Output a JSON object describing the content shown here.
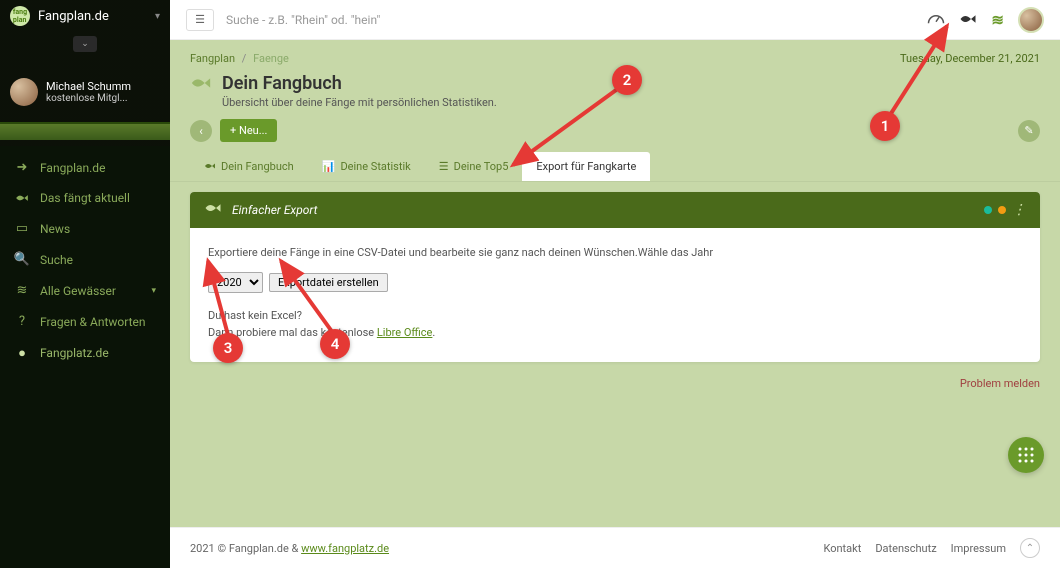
{
  "brand": {
    "name": "Fangplan.de"
  },
  "user": {
    "name": "Michael Schumm",
    "sub": "kostenlose Mitgl..."
  },
  "nav": [
    {
      "label": "Fangplan.de",
      "icon": "➜"
    },
    {
      "label": "Das fängt aktuell",
      "icon": "fish"
    },
    {
      "label": "News",
      "icon": "▭"
    },
    {
      "label": "Suche",
      "icon": "🔍"
    },
    {
      "label": "Alle Gewässer",
      "icon": "≋",
      "chev": true
    },
    {
      "label": "Fragen & Antworten",
      "icon": "?"
    },
    {
      "label": "Fangplatz.de",
      "icon": "●"
    }
  ],
  "search": {
    "placeholder": "Suche - z.B. \"Rhein\" od. \"hein\""
  },
  "crumbs": {
    "root": "Fangplan",
    "leaf": "Faenge",
    "date": "Tuesday, December 21, 2021"
  },
  "page": {
    "title": "Dein Fangbuch",
    "sub": "Übersicht über deine Fänge mit persönlichen Statistiken."
  },
  "controls": {
    "new": "+ Neu..."
  },
  "tabs": [
    {
      "label": "Dein Fangbuch",
      "icon": "fish"
    },
    {
      "label": "Deine Statistik",
      "icon": "chart"
    },
    {
      "label": "Deine Top5",
      "icon": "list"
    },
    {
      "label": "Export für Fangkarte",
      "icon": "",
      "active": true
    }
  ],
  "panel": {
    "title": "Einfacher Export",
    "desc": "Exportiere deine Fänge in eine CSV-Datei und bearbeite sie ganz nach deinen Wünschen.Wähle das Jahr",
    "year": "2020",
    "export_btn": "Exportdatei erstellen",
    "hint1": "Du hast kein Excel?",
    "hint2_prefix": "Dann probiere mal das kostenlose ",
    "hint2_link": "Libre Office",
    "hint2_suffix": "."
  },
  "problem": "Problem melden",
  "footer": {
    "copy_prefix": "2021 © Fangplan.de & ",
    "copy_link": "www.fangplatz.de",
    "links": [
      "Kontakt",
      "Datenschutz",
      "Impressum"
    ]
  },
  "anno": {
    "1": "1",
    "2": "2",
    "3": "3",
    "4": "4"
  }
}
